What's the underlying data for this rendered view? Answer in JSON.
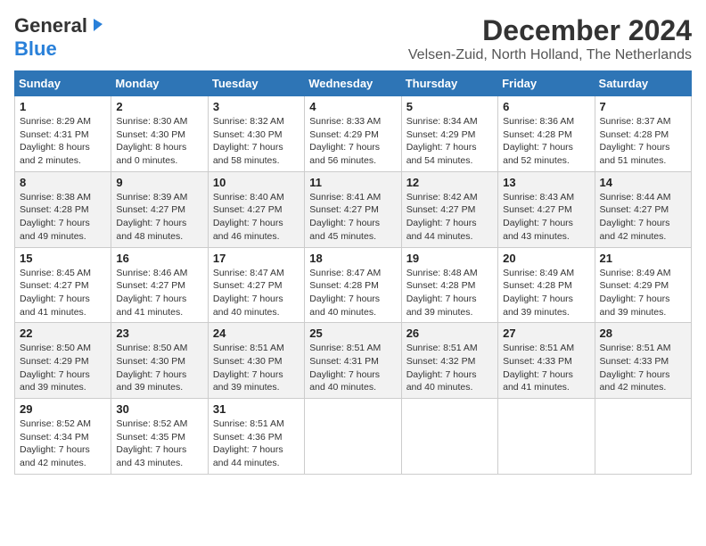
{
  "logo": {
    "line1": "General",
    "line2": "Blue"
  },
  "title": "December 2024",
  "subtitle": "Velsen-Zuid, North Holland, The Netherlands",
  "days_of_week": [
    "Sunday",
    "Monday",
    "Tuesday",
    "Wednesday",
    "Thursday",
    "Friday",
    "Saturday"
  ],
  "weeks": [
    [
      {
        "day": 1,
        "info": "Sunrise: 8:29 AM\nSunset: 4:31 PM\nDaylight: 8 hours\nand 2 minutes."
      },
      {
        "day": 2,
        "info": "Sunrise: 8:30 AM\nSunset: 4:30 PM\nDaylight: 8 hours\nand 0 minutes."
      },
      {
        "day": 3,
        "info": "Sunrise: 8:32 AM\nSunset: 4:30 PM\nDaylight: 7 hours\nand 58 minutes."
      },
      {
        "day": 4,
        "info": "Sunrise: 8:33 AM\nSunset: 4:29 PM\nDaylight: 7 hours\nand 56 minutes."
      },
      {
        "day": 5,
        "info": "Sunrise: 8:34 AM\nSunset: 4:29 PM\nDaylight: 7 hours\nand 54 minutes."
      },
      {
        "day": 6,
        "info": "Sunrise: 8:36 AM\nSunset: 4:28 PM\nDaylight: 7 hours\nand 52 minutes."
      },
      {
        "day": 7,
        "info": "Sunrise: 8:37 AM\nSunset: 4:28 PM\nDaylight: 7 hours\nand 51 minutes."
      }
    ],
    [
      {
        "day": 8,
        "info": "Sunrise: 8:38 AM\nSunset: 4:28 PM\nDaylight: 7 hours\nand 49 minutes."
      },
      {
        "day": 9,
        "info": "Sunrise: 8:39 AM\nSunset: 4:27 PM\nDaylight: 7 hours\nand 48 minutes."
      },
      {
        "day": 10,
        "info": "Sunrise: 8:40 AM\nSunset: 4:27 PM\nDaylight: 7 hours\nand 46 minutes."
      },
      {
        "day": 11,
        "info": "Sunrise: 8:41 AM\nSunset: 4:27 PM\nDaylight: 7 hours\nand 45 minutes."
      },
      {
        "day": 12,
        "info": "Sunrise: 8:42 AM\nSunset: 4:27 PM\nDaylight: 7 hours\nand 44 minutes."
      },
      {
        "day": 13,
        "info": "Sunrise: 8:43 AM\nSunset: 4:27 PM\nDaylight: 7 hours\nand 43 minutes."
      },
      {
        "day": 14,
        "info": "Sunrise: 8:44 AM\nSunset: 4:27 PM\nDaylight: 7 hours\nand 42 minutes."
      }
    ],
    [
      {
        "day": 15,
        "info": "Sunrise: 8:45 AM\nSunset: 4:27 PM\nDaylight: 7 hours\nand 41 minutes."
      },
      {
        "day": 16,
        "info": "Sunrise: 8:46 AM\nSunset: 4:27 PM\nDaylight: 7 hours\nand 41 minutes."
      },
      {
        "day": 17,
        "info": "Sunrise: 8:47 AM\nSunset: 4:27 PM\nDaylight: 7 hours\nand 40 minutes."
      },
      {
        "day": 18,
        "info": "Sunrise: 8:47 AM\nSunset: 4:28 PM\nDaylight: 7 hours\nand 40 minutes."
      },
      {
        "day": 19,
        "info": "Sunrise: 8:48 AM\nSunset: 4:28 PM\nDaylight: 7 hours\nand 39 minutes."
      },
      {
        "day": 20,
        "info": "Sunrise: 8:49 AM\nSunset: 4:28 PM\nDaylight: 7 hours\nand 39 minutes."
      },
      {
        "day": 21,
        "info": "Sunrise: 8:49 AM\nSunset: 4:29 PM\nDaylight: 7 hours\nand 39 minutes."
      }
    ],
    [
      {
        "day": 22,
        "info": "Sunrise: 8:50 AM\nSunset: 4:29 PM\nDaylight: 7 hours\nand 39 minutes."
      },
      {
        "day": 23,
        "info": "Sunrise: 8:50 AM\nSunset: 4:30 PM\nDaylight: 7 hours\nand 39 minutes."
      },
      {
        "day": 24,
        "info": "Sunrise: 8:51 AM\nSunset: 4:30 PM\nDaylight: 7 hours\nand 39 minutes."
      },
      {
        "day": 25,
        "info": "Sunrise: 8:51 AM\nSunset: 4:31 PM\nDaylight: 7 hours\nand 40 minutes."
      },
      {
        "day": 26,
        "info": "Sunrise: 8:51 AM\nSunset: 4:32 PM\nDaylight: 7 hours\nand 40 minutes."
      },
      {
        "day": 27,
        "info": "Sunrise: 8:51 AM\nSunset: 4:33 PM\nDaylight: 7 hours\nand 41 minutes."
      },
      {
        "day": 28,
        "info": "Sunrise: 8:51 AM\nSunset: 4:33 PM\nDaylight: 7 hours\nand 42 minutes."
      }
    ],
    [
      {
        "day": 29,
        "info": "Sunrise: 8:52 AM\nSunset: 4:34 PM\nDaylight: 7 hours\nand 42 minutes."
      },
      {
        "day": 30,
        "info": "Sunrise: 8:52 AM\nSunset: 4:35 PM\nDaylight: 7 hours\nand 43 minutes."
      },
      {
        "day": 31,
        "info": "Sunrise: 8:51 AM\nSunset: 4:36 PM\nDaylight: 7 hours\nand 44 minutes."
      },
      null,
      null,
      null,
      null
    ]
  ]
}
